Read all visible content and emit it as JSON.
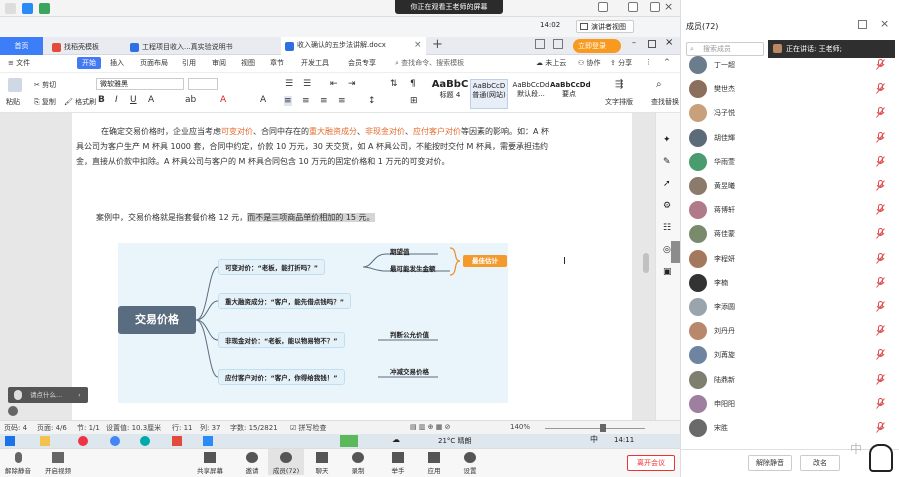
{
  "meeting": {
    "banner": "你正在观看王老师的屏幕",
    "time": "14:02",
    "view_label": "演讲者视图"
  },
  "wps": {
    "home_tab": "首页",
    "tabs": [
      "找稻壳模板",
      "工程项目收入...真实验说明书",
      "收入确认的五步法讲解.docx"
    ],
    "login_label": "立即登录",
    "menu": [
      "文件",
      "开始",
      "插入",
      "页面布局",
      "引用",
      "审阅",
      "视图",
      "章节",
      "开发工具",
      "会员专享"
    ],
    "search_placeholder": "查找命令、搜索模板",
    "cloud_label": "未上云",
    "collab_label": "协作",
    "share_label": "分享",
    "ribbon": {
      "paste": "粘贴",
      "cut": "剪切",
      "copy": "复制",
      "format_painter": "格式刷",
      "font": "微软雅黑",
      "styles": [
        {
          "sample": "AaBbC",
          "name": "标题 4"
        },
        {
          "sample": "AaBbCcD",
          "name": "普通(网站)"
        },
        {
          "sample": "AaBbCcDd",
          "name": "默认段..."
        },
        {
          "sample": "AaBbCcDd",
          "name": "要点"
        }
      ],
      "text_layout": "文字排版",
      "find_replace": "查找替换"
    }
  },
  "document": {
    "para1_a": "在确定交易价格时，企业应当考虑",
    "para1_b": "可变对价",
    "para1_c": "、合同中存在的",
    "para1_d": "重大融资成分",
    "para1_e": "、",
    "para1_f": "非现金对价",
    "para1_g": "、",
    "para1_h": "应付客户对价",
    "para1_i": "等因素的影响。如：A 杯具公司为客户生产 M 杯具 1000 套，合同中约定，价款 10 万元，30 天交货，如 A 杯具公司，不能按时交付 M 杯具，需要承担违约金，直接从价款中扣除。A 杯具公司与客户的 M 杯具合同包含 10 万元的固定价格和 1 万元的可变对价。",
    "para2_a": "案例中，交易价格就是指套餐价格 12 元，",
    "para2_b": "而不是三项商品单价相加的 15 元。"
  },
  "mindmap": {
    "root": "交易价格",
    "branches": [
      "可变对价：“老板，能打折吗？”",
      "重大融资成分：“客户，能先借点钱吗？”",
      "非现金对价：“老板，能以物易物不？”",
      "应付客户对价：“客户，你得给我钱！”"
    ],
    "leaves": [
      "期望值",
      "最可能发生金额",
      "判断公允价值",
      "冲减交易价格"
    ],
    "callout": "最佳估计"
  },
  "float_toolbar": "请点什么...",
  "statusbar": {
    "page": "页码: 4",
    "pages": "页面: 4/6",
    "section": "节: 1/1",
    "setting": "设置值: 10.3厘米",
    "row": "行: 11",
    "col": "列: 37",
    "words": "字数: 15/2821",
    "spell": "拼写检查",
    "zoom": "140%"
  },
  "taskbar": {
    "weather": "21°C 晴朗",
    "time": "14:11",
    "ime": "中"
  },
  "meeting_bar": {
    "buttons": [
      "解除静音",
      "开启视频",
      "共享屏幕",
      "邀请",
      "成员(72)",
      "聊天",
      "录制",
      "举手",
      "应用",
      "设置"
    ],
    "leave": "离开会议"
  },
  "panel": {
    "title": "成员(72)",
    "search_placeholder": "搜索成员",
    "speaking": "正在讲话: 王老师;",
    "members": [
      "丁一超",
      "樊世杰",
      "冯子悦",
      "胡佳輝",
      "华雨萱",
      "黄昱曦",
      "蒋博轩",
      "蒋佳蒙",
      "李程妍",
      "李楠",
      "李添圆",
      "刘丹丹",
      "刘苒旋",
      "陆鼎新",
      "申阳阳",
      "宋胜"
    ],
    "unmute_all": "解除静音",
    "rename": "改名"
  },
  "colors": {
    "accent": "#3d7ef8",
    "orange": "#e46b2c",
    "mic_muted": "#e04a4a"
  }
}
